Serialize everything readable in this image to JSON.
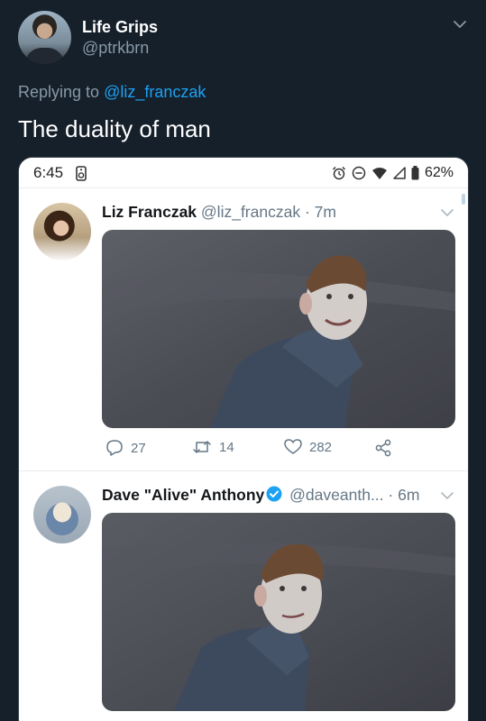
{
  "author": {
    "display_name": "Life Grips",
    "handle": "@ptrkbrn"
  },
  "reply": {
    "prefix": "Replying to",
    "mention": "@liz_franczak"
  },
  "tweet_text": "The duality of man",
  "phone_status": {
    "time": "6:45",
    "battery": "62%"
  },
  "inner_tweets": [
    {
      "display_name": "Liz Franczak",
      "handle": "@liz_franczak",
      "time": "· 7m",
      "replies": "27",
      "retweets": "14",
      "likes": "282"
    },
    {
      "display_name": "Dave \"Alive\" Anthony",
      "handle": "@daveanth...",
      "time": "· 6m",
      "verified": true
    }
  ],
  "icons": {
    "chevron": "chevron-down-icon",
    "reply": "reply-icon",
    "retweet": "retweet-icon",
    "like": "heart-icon",
    "share": "share-icon",
    "verified": "verified-badge-icon"
  },
  "colors": {
    "background": "#15202b",
    "accent": "#1da1f2",
    "muted": "#8899a6"
  }
}
